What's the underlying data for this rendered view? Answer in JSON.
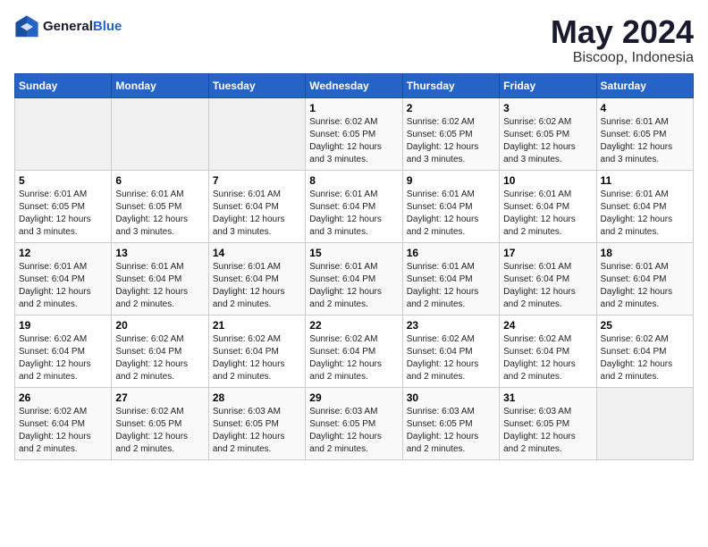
{
  "logo": {
    "line1": "General",
    "line2": "Blue"
  },
  "title": "May 2024",
  "subtitle": "Biscoop, Indonesia",
  "days_header": [
    "Sunday",
    "Monday",
    "Tuesday",
    "Wednesday",
    "Thursday",
    "Friday",
    "Saturday"
  ],
  "weeks": [
    [
      {
        "day": "",
        "info": ""
      },
      {
        "day": "",
        "info": ""
      },
      {
        "day": "",
        "info": ""
      },
      {
        "day": "1",
        "info": "Sunrise: 6:02 AM\nSunset: 6:05 PM\nDaylight: 12 hours\nand 3 minutes."
      },
      {
        "day": "2",
        "info": "Sunrise: 6:02 AM\nSunset: 6:05 PM\nDaylight: 12 hours\nand 3 minutes."
      },
      {
        "day": "3",
        "info": "Sunrise: 6:02 AM\nSunset: 6:05 PM\nDaylight: 12 hours\nand 3 minutes."
      },
      {
        "day": "4",
        "info": "Sunrise: 6:01 AM\nSunset: 6:05 PM\nDaylight: 12 hours\nand 3 minutes."
      }
    ],
    [
      {
        "day": "5",
        "info": "Sunrise: 6:01 AM\nSunset: 6:05 PM\nDaylight: 12 hours\nand 3 minutes."
      },
      {
        "day": "6",
        "info": "Sunrise: 6:01 AM\nSunset: 6:05 PM\nDaylight: 12 hours\nand 3 minutes."
      },
      {
        "day": "7",
        "info": "Sunrise: 6:01 AM\nSunset: 6:04 PM\nDaylight: 12 hours\nand 3 minutes."
      },
      {
        "day": "8",
        "info": "Sunrise: 6:01 AM\nSunset: 6:04 PM\nDaylight: 12 hours\nand 3 minutes."
      },
      {
        "day": "9",
        "info": "Sunrise: 6:01 AM\nSunset: 6:04 PM\nDaylight: 12 hours\nand 2 minutes."
      },
      {
        "day": "10",
        "info": "Sunrise: 6:01 AM\nSunset: 6:04 PM\nDaylight: 12 hours\nand 2 minutes."
      },
      {
        "day": "11",
        "info": "Sunrise: 6:01 AM\nSunset: 6:04 PM\nDaylight: 12 hours\nand 2 minutes."
      }
    ],
    [
      {
        "day": "12",
        "info": "Sunrise: 6:01 AM\nSunset: 6:04 PM\nDaylight: 12 hours\nand 2 minutes."
      },
      {
        "day": "13",
        "info": "Sunrise: 6:01 AM\nSunset: 6:04 PM\nDaylight: 12 hours\nand 2 minutes."
      },
      {
        "day": "14",
        "info": "Sunrise: 6:01 AM\nSunset: 6:04 PM\nDaylight: 12 hours\nand 2 minutes."
      },
      {
        "day": "15",
        "info": "Sunrise: 6:01 AM\nSunset: 6:04 PM\nDaylight: 12 hours\nand 2 minutes."
      },
      {
        "day": "16",
        "info": "Sunrise: 6:01 AM\nSunset: 6:04 PM\nDaylight: 12 hours\nand 2 minutes."
      },
      {
        "day": "17",
        "info": "Sunrise: 6:01 AM\nSunset: 6:04 PM\nDaylight: 12 hours\nand 2 minutes."
      },
      {
        "day": "18",
        "info": "Sunrise: 6:01 AM\nSunset: 6:04 PM\nDaylight: 12 hours\nand 2 minutes."
      }
    ],
    [
      {
        "day": "19",
        "info": "Sunrise: 6:02 AM\nSunset: 6:04 PM\nDaylight: 12 hours\nand 2 minutes."
      },
      {
        "day": "20",
        "info": "Sunrise: 6:02 AM\nSunset: 6:04 PM\nDaylight: 12 hours\nand 2 minutes."
      },
      {
        "day": "21",
        "info": "Sunrise: 6:02 AM\nSunset: 6:04 PM\nDaylight: 12 hours\nand 2 minutes."
      },
      {
        "day": "22",
        "info": "Sunrise: 6:02 AM\nSunset: 6:04 PM\nDaylight: 12 hours\nand 2 minutes."
      },
      {
        "day": "23",
        "info": "Sunrise: 6:02 AM\nSunset: 6:04 PM\nDaylight: 12 hours\nand 2 minutes."
      },
      {
        "day": "24",
        "info": "Sunrise: 6:02 AM\nSunset: 6:04 PM\nDaylight: 12 hours\nand 2 minutes."
      },
      {
        "day": "25",
        "info": "Sunrise: 6:02 AM\nSunset: 6:04 PM\nDaylight: 12 hours\nand 2 minutes."
      }
    ],
    [
      {
        "day": "26",
        "info": "Sunrise: 6:02 AM\nSunset: 6:04 PM\nDaylight: 12 hours\nand 2 minutes."
      },
      {
        "day": "27",
        "info": "Sunrise: 6:02 AM\nSunset: 6:05 PM\nDaylight: 12 hours\nand 2 minutes."
      },
      {
        "day": "28",
        "info": "Sunrise: 6:03 AM\nSunset: 6:05 PM\nDaylight: 12 hours\nand 2 minutes."
      },
      {
        "day": "29",
        "info": "Sunrise: 6:03 AM\nSunset: 6:05 PM\nDaylight: 12 hours\nand 2 minutes."
      },
      {
        "day": "30",
        "info": "Sunrise: 6:03 AM\nSunset: 6:05 PM\nDaylight: 12 hours\nand 2 minutes."
      },
      {
        "day": "31",
        "info": "Sunrise: 6:03 AM\nSunset: 6:05 PM\nDaylight: 12 hours\nand 2 minutes."
      },
      {
        "day": "",
        "info": ""
      }
    ]
  ]
}
